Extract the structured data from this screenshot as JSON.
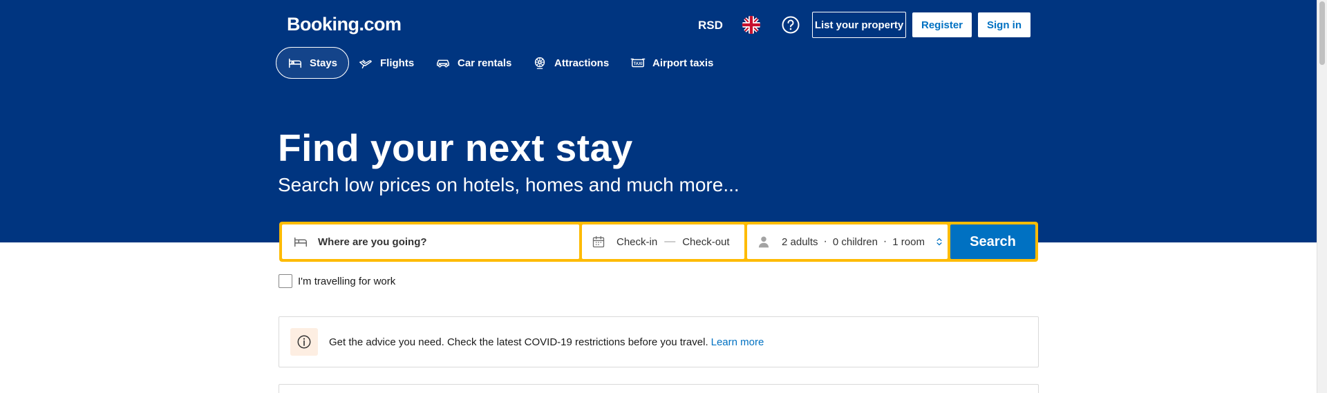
{
  "header": {
    "logo": "Booking.com",
    "currency": "RSD",
    "list_property": "List your property",
    "register": "Register",
    "sign_in": "Sign in"
  },
  "nav": {
    "tabs": [
      {
        "label": "Stays",
        "icon": "bed-icon",
        "active": true
      },
      {
        "label": "Flights",
        "icon": "plane-icon",
        "active": false
      },
      {
        "label": "Car rentals",
        "icon": "car-icon",
        "active": false
      },
      {
        "label": "Attractions",
        "icon": "attractions-icon",
        "active": false
      },
      {
        "label": "Airport taxis",
        "icon": "taxi-icon",
        "active": false
      }
    ]
  },
  "hero": {
    "title": "Find your next stay",
    "subtitle": "Search low prices on hotels, homes and much more..."
  },
  "search": {
    "destination_placeholder": "Where are you going?",
    "check_in": "Check-in",
    "dash": "—",
    "check_out": "Check-out",
    "adults": "2 adults",
    "children": "0 children",
    "rooms": "1 room",
    "separator": "·",
    "button": "Search"
  },
  "work_travel": {
    "label": "I'm travelling for work"
  },
  "notice": {
    "text": "Get the advice you need. Check the latest COVID-19 restrictions before you travel.",
    "link": "Learn more"
  },
  "colors": {
    "brand_blue": "#003580",
    "accent_yellow": "#febb02",
    "button_blue": "#0071c2"
  }
}
